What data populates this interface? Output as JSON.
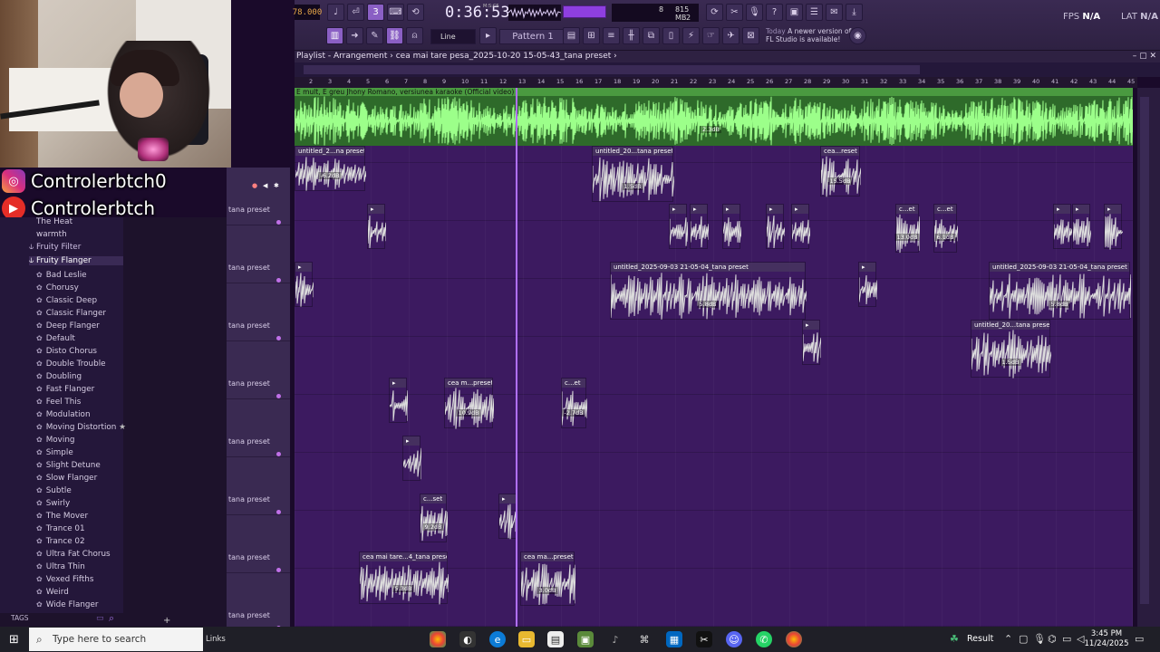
{
  "toolbar": {
    "bpm": "78.000",
    "time": "0:36:53",
    "mcs": "M:S:CS",
    "cpu_num": "8",
    "memory": "815 MB",
    "voices": "2",
    "fps_label": "FPS",
    "fps_value": "N/A",
    "lat_label": "LAT",
    "lat_value": "N/A",
    "snap": "Line",
    "pattern": "Pattern 1",
    "news_date": "Today",
    "news_text": "A newer version of FL Studio is available!"
  },
  "social": {
    "instagram": "Controlerbtch0",
    "youtube": "Controlerbtch"
  },
  "browser": {
    "top_items": [
      "The Heat",
      "warmth"
    ],
    "folders": [
      "Fruity Filter",
      "Fruity Flanger"
    ],
    "presets": [
      "Bad Leslie",
      "Chorusy",
      "Classic Deep",
      "Classic Flanger",
      "Deep Flanger",
      "Default",
      "Disto Chorus",
      "Double Trouble",
      "Doubling",
      "Fast Flanger",
      "Feel This",
      "Modulation",
      "Moving Distortion",
      "Moving",
      "Simple",
      "Slight Detune",
      "Slow Flanger",
      "Subtle",
      "Swirly",
      "The Mover",
      "Trance 01",
      "Trance 02",
      "Ultra Fat Chorus",
      "Ultra Thin",
      "Vexed Fifths",
      "Weird",
      "Wide Flanger"
    ],
    "tags": "TAGS"
  },
  "playlist": {
    "title": "Playlist - Arrangement",
    "arrangement": "cea mai tare pesa_2025-10-20 15-05-43_tana preset",
    "ruler": [
      "2",
      "3",
      "4",
      "5",
      "6",
      "7",
      "8",
      "9",
      "10",
      "11",
      "12",
      "13",
      "14",
      "15",
      "16",
      "17",
      "18",
      "19",
      "20",
      "21",
      "22",
      "23",
      "24",
      "25",
      "26",
      "27",
      "28",
      "29",
      "30",
      "31",
      "32",
      "33",
      "34",
      "35",
      "36",
      "37",
      "38",
      "39",
      "40",
      "41",
      "42",
      "43",
      "44",
      "45"
    ],
    "audio_track_title": "E mult, E greu  Jhony Romano, versiunea karaoke (Official video)",
    "audio_track_db": "2.3dB",
    "track_name": "tana preset",
    "clips": [
      {
        "label": "untitled_2...na preset",
        "db": "-6.2dB"
      },
      {
        "label": "untitled_20...tana preset",
        "db": "1.5dB"
      },
      {
        "label": "cea...reset",
        "db": "15.5dB"
      },
      {
        "label": "c...et",
        "db": "13.0dB"
      },
      {
        "label": "c...et",
        "db": "6.1dB"
      },
      {
        "label": "untitled_2025-09-03 21-05-04_tana preset",
        "db": "5.8dB"
      },
      {
        "label": "untitled_2025-09-03 21-05-04_tana preset",
        "db": "5.8dB"
      },
      {
        "label": "untitled_20...tana preset",
        "db": "1.5dB"
      },
      {
        "label": "cea m...preset",
        "db": "10.9dB"
      },
      {
        "label": "c...et",
        "db": "-2.7dB"
      },
      {
        "label": "c...set",
        "db": "9.2dB"
      },
      {
        "label": "cea mai tare...4_tana preset",
        "db": "5.3dB"
      },
      {
        "label": "cea ma...preset",
        "db": "3.0dB"
      }
    ]
  },
  "taskbar": {
    "search_placeholder": "Type here to search",
    "links": "Links",
    "result": "Result",
    "time": "3:45 PM",
    "date": "11/24/2025"
  }
}
